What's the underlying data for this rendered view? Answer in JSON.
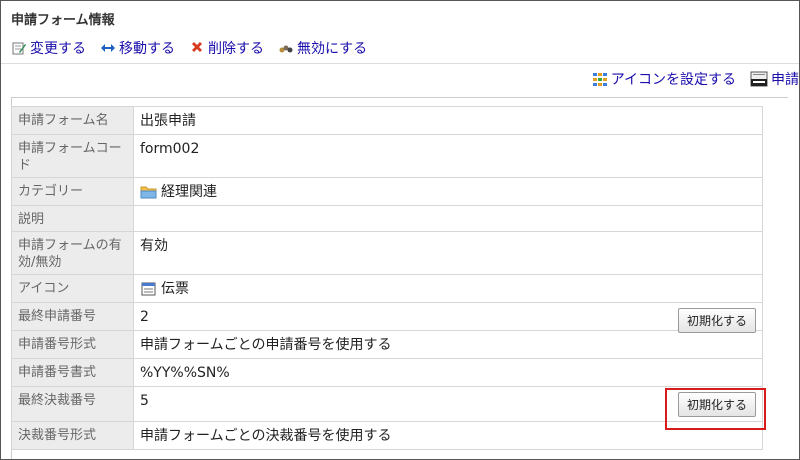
{
  "page": {
    "title": "申請フォーム情報"
  },
  "toolbar": {
    "edit_label": "変更する",
    "move_label": "移動する",
    "delete_label": "削除する",
    "disable_label": "無効にする"
  },
  "right_toolbar": {
    "set_icon_label": "アイコンを設定する",
    "truncated_label": "申請"
  },
  "rows": [
    {
      "label": "申請フォーム名",
      "value": "出張申請"
    },
    {
      "label": "申請フォームコード",
      "value": "form002"
    },
    {
      "label": "カテゴリー",
      "value": "経理関連"
    },
    {
      "label": "説明",
      "value": ""
    },
    {
      "label": "申請フォームの有効/無効",
      "value": "有効"
    },
    {
      "label": "アイコン",
      "value": "伝票"
    },
    {
      "label": "最終申請番号",
      "value": "2",
      "button": "初期化する"
    },
    {
      "label": "申請番号形式",
      "value": "申請フォームごとの申請番号を使用する"
    },
    {
      "label": "申請番号書式",
      "value": "%YY%%SN%"
    },
    {
      "label": "最終決裁番号",
      "value": "5",
      "button": "初期化する"
    },
    {
      "label": "決裁番号形式",
      "value": "申請フォームごとの決裁番号を使用する"
    }
  ],
  "icons": {
    "edit": "edit-note-icon",
    "move": "move-arrows-icon",
    "delete": "delete-x-icon",
    "disable": "disable-icon",
    "set_icon": "icon-grid-icon",
    "form_id": "form-id-icon",
    "category": "folder-icon",
    "slip": "slip-icon"
  },
  "colors": {
    "link": "#1a0dab",
    "enabled": "#1a9a1a",
    "highlight": "#d61c1c"
  }
}
